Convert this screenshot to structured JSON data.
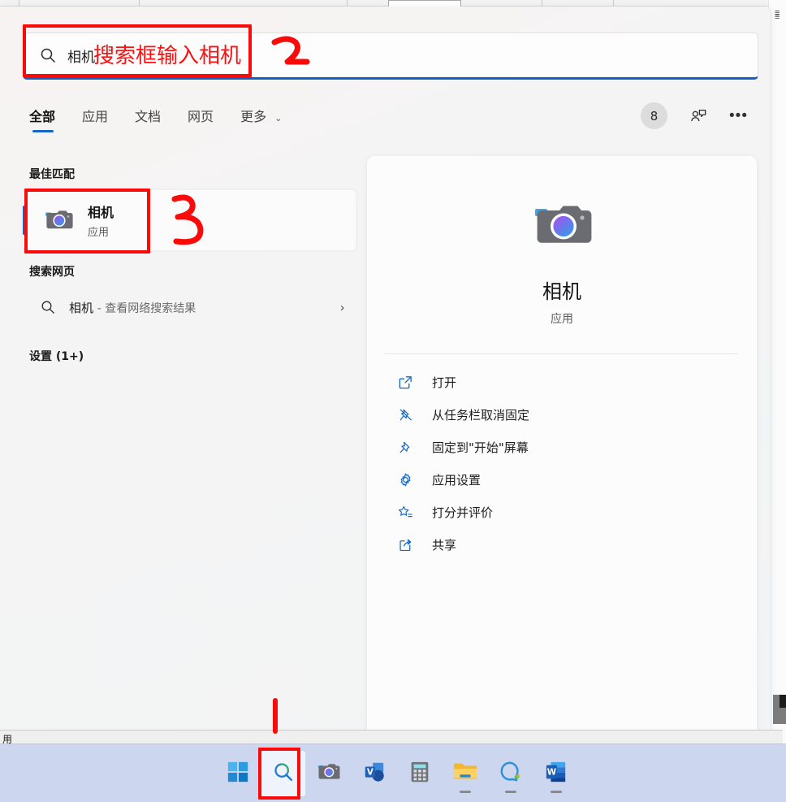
{
  "search": {
    "value": "相机",
    "icon": "search-icon"
  },
  "tabs": [
    {
      "label": "全部",
      "active": true
    },
    {
      "label": "应用",
      "active": false
    },
    {
      "label": "文档",
      "active": false
    },
    {
      "label": "网页",
      "active": false
    },
    {
      "label": "更多",
      "active": false,
      "chevron": "⌄"
    }
  ],
  "topright": {
    "avatar_text": "8",
    "feedback_icon": "person-feedback-icon",
    "more_label": "•••"
  },
  "sections": {
    "best_match_heading": "最佳匹配",
    "web_search_heading": "搜索网页",
    "settings_heading": "设置 (1+)"
  },
  "best_match": {
    "title": "相机",
    "subtitle": "应用",
    "icon": "camera-app-icon"
  },
  "web_search": {
    "query": "相机",
    "suffix": "- 查看网络搜索结果",
    "chevron": "›"
  },
  "detail": {
    "title": "相机",
    "subtitle": "应用",
    "icon": "camera-app-icon",
    "actions": [
      {
        "label": "打开",
        "icon": "open-external-icon"
      },
      {
        "label": "从任务栏取消固定",
        "icon": "unpin-icon"
      },
      {
        "label": "固定到\"开始\"屏幕",
        "icon": "pin-icon"
      },
      {
        "label": "应用设置",
        "icon": "gear-icon"
      },
      {
        "label": "打分并评价",
        "icon": "rate-star-icon"
      },
      {
        "label": "共享",
        "icon": "share-icon"
      }
    ]
  },
  "taskbar": {
    "items": [
      {
        "name": "start-button",
        "icon": "windows-logo-icon",
        "running": false,
        "highlighted": false
      },
      {
        "name": "search-button",
        "icon": "search-icon",
        "running": false,
        "highlighted": true
      },
      {
        "name": "camera-app",
        "icon": "camera-icon",
        "running": false,
        "highlighted": false
      },
      {
        "name": "visio-app",
        "icon": "visio-icon",
        "running": false,
        "highlighted": false
      },
      {
        "name": "calculator-app",
        "icon": "calculator-icon",
        "running": false,
        "highlighted": false
      },
      {
        "name": "file-explorer",
        "icon": "folder-icon",
        "running": true,
        "highlighted": false
      },
      {
        "name": "chat-app",
        "icon": "chat-icon",
        "running": true,
        "highlighted": false
      },
      {
        "name": "word-app",
        "icon": "word-icon",
        "running": true,
        "highlighted": false
      }
    ]
  },
  "annotations": {
    "step1": "1",
    "step2": "2",
    "step3": "3",
    "searchbox_note": "搜索框输入相机"
  },
  "background": {
    "bottom_left_char": "用"
  },
  "colors": {
    "accent_blue": "#1664c8",
    "annotation_red": "#fb0a0a",
    "taskbar": "#ccd7ef",
    "panel_bg": "#f4f4f5"
  }
}
